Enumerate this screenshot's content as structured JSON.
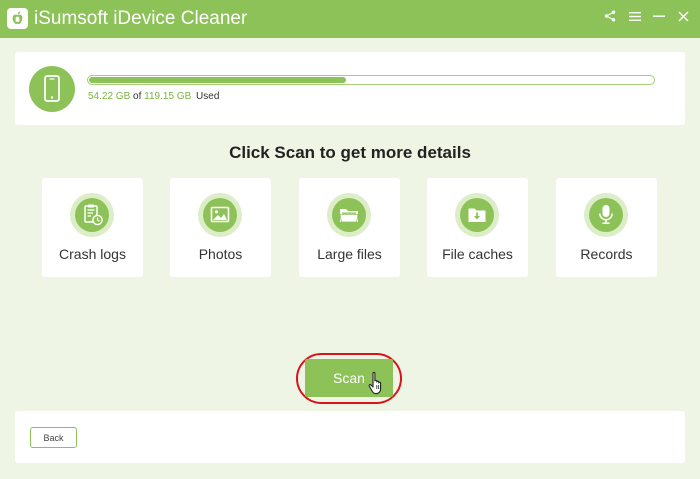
{
  "window": {
    "title": "iSumsoft iDevice Cleaner",
    "controls": [
      "share-icon",
      "menu-icon",
      "minimize-icon",
      "close-icon"
    ]
  },
  "storage": {
    "used": "54.22 GB",
    "of_label": "of",
    "total": "119.15 GB",
    "used_label": "Used",
    "used_fraction": 0.455
  },
  "heading": "Click Scan to get more details",
  "categories": [
    {
      "label": "Crash logs",
      "icon": "crash-logs-icon"
    },
    {
      "label": "Photos",
      "icon": "photos-icon"
    },
    {
      "label": "Large files",
      "icon": "large-files-icon"
    },
    {
      "label": "File caches",
      "icon": "file-caches-icon"
    },
    {
      "label": "Records",
      "icon": "records-icon"
    }
  ],
  "scan_button": {
    "label": "Scan"
  },
  "back_button": {
    "label": "Back"
  },
  "colors": {
    "accent": "#8dc259",
    "background": "#eff5e4",
    "highlight": "#d7141c"
  }
}
